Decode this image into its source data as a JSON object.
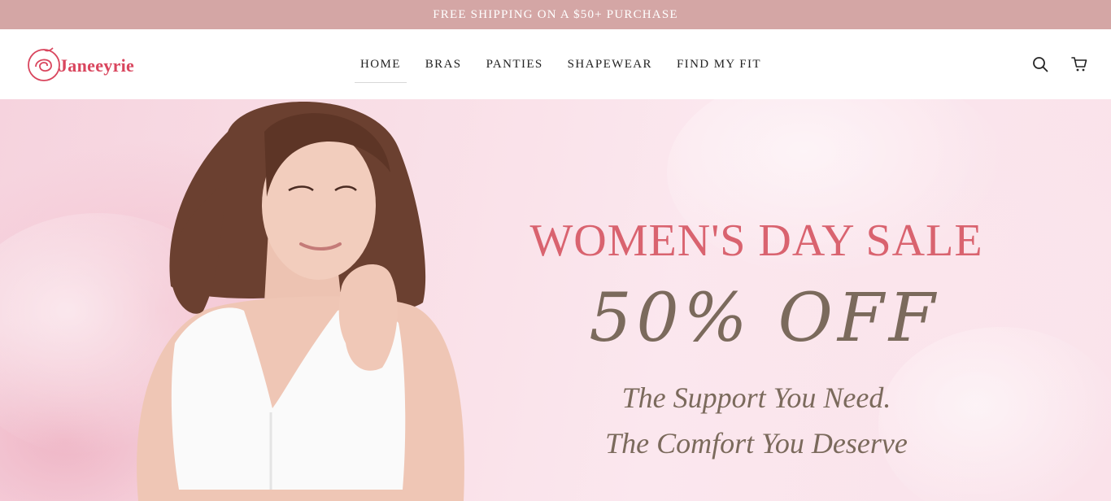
{
  "announcement": {
    "text": "FREE SHIPPING ON A $50+ PURCHASE"
  },
  "brand": {
    "name": "Janeeyrie",
    "logo_icon": "rose-logo-icon",
    "color": "#d9465e"
  },
  "nav": {
    "items": [
      {
        "label": "HOME",
        "active": true
      },
      {
        "label": "BRAS"
      },
      {
        "label": "PANTIES"
      },
      {
        "label": "SHAPEWEAR"
      },
      {
        "label": "FIND MY FIT"
      }
    ]
  },
  "header_icons": {
    "search": "search-icon",
    "cart": "cart-icon"
  },
  "hero": {
    "headline": "WOMEN'S DAY SALE",
    "offer": "50% OFF",
    "tagline_1": "The Support You Need.",
    "tagline_2": "The Comfort You Deserve",
    "colors": {
      "headline": "#d9636f",
      "offer": "#7b6a5c",
      "background": "#f9dfe7"
    }
  },
  "colors": {
    "announcement_bg": "#d4a6a5"
  }
}
